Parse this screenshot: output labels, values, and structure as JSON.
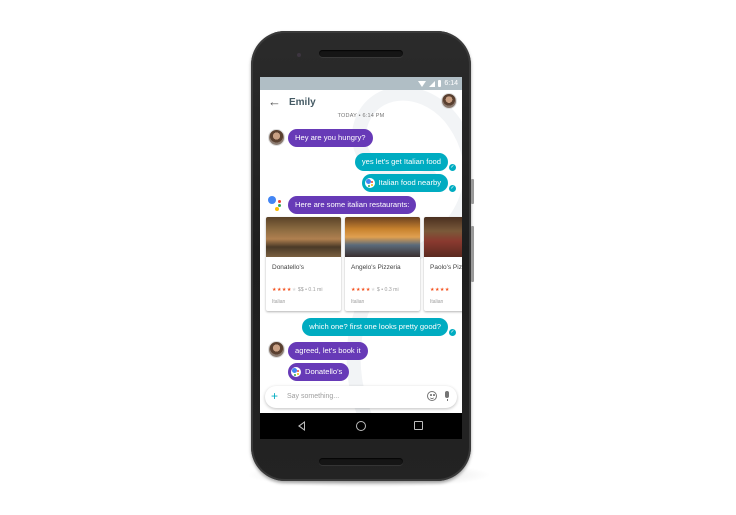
{
  "status_bar": {
    "time": "6:14",
    "icons": [
      "wifi-icon",
      "signal-icon",
      "battery-icon"
    ]
  },
  "app_bar": {
    "back_icon": "arrow-left-icon",
    "title": "Emily",
    "avatar": "contact-avatar"
  },
  "timestamp": "TODAY • 6:14 PM",
  "messages": [
    {
      "side": "in",
      "sender": "Emily",
      "text": "Hey are you hungry?"
    },
    {
      "side": "out",
      "text": "yes let's get Italian food",
      "delivered": true
    },
    {
      "side": "out",
      "text": "Italian food nearby",
      "assistant_query": true,
      "delivered": true
    },
    {
      "side": "in",
      "sender": "Google Assistant",
      "text": "Here are some italian restaurants:"
    },
    {
      "side": "out",
      "text": "which one? first one looks pretty good?",
      "delivered": true
    },
    {
      "side": "in",
      "sender": "Emily",
      "text": "agreed, let's book it"
    },
    {
      "side": "in",
      "sender": "Emily",
      "text": "Donatello's",
      "assistant_query": true
    }
  ],
  "restaurants": [
    {
      "name": "Donatello's",
      "rating": 4,
      "max_rating": 5,
      "price": "$$",
      "distance": "0.1 mi",
      "meta": "$$ • 0.1 mi",
      "category": "Italian"
    },
    {
      "name": "Angelo's Pizzeria",
      "rating": 4,
      "max_rating": 5,
      "price": "$",
      "distance": "0.3 mi",
      "meta": "$ • 0.3 mi",
      "category": "Italian"
    },
    {
      "name": "Paolo's Pizza",
      "rating": 4,
      "max_rating": 5,
      "price": "",
      "distance": "",
      "meta": "",
      "category": "Italian"
    }
  ],
  "composer": {
    "placeholder": "Say something...",
    "add_icon": "plus-icon",
    "emoji_icon": "emoji-icon",
    "mic_icon": "mic-icon"
  },
  "nav_bar": {
    "back": "nav-back-icon",
    "home": "nav-home-icon",
    "recents": "nav-recents-icon"
  },
  "colors": {
    "incoming": "#673ab7",
    "outgoing": "#00acc1",
    "status_bar": "#b0bec5",
    "title": "#455a64",
    "stars": "#f4511e"
  }
}
